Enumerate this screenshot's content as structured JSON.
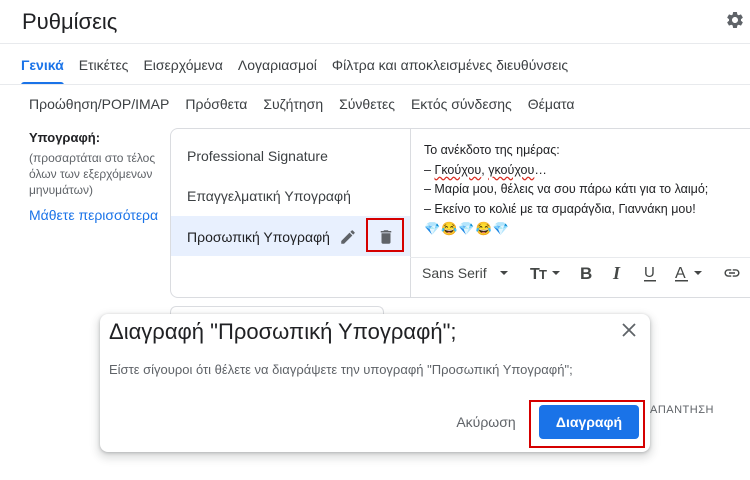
{
  "header": {
    "title": "Ρυθμίσεις",
    "settings_icon": "gear-icon"
  },
  "tabs_row1": [
    "Γενικά",
    "Ετικέτες",
    "Εισερχόμενα",
    "Λογαριασμοί",
    "Φίλτρα και αποκλεισμένες διευθύνσεις"
  ],
  "tabs_row2": [
    "Προώθηση/POP/IMAP",
    "Πρόσθετα",
    "Συζήτηση",
    "Σύνθετες",
    "Εκτός σύνδεσης",
    "Θέματα"
  ],
  "active_tab": "Γενικά",
  "signature_section": {
    "label": "Υπογραφή:",
    "desc_line1": "(προσαρτάται στο τέλος",
    "desc_line2": "όλων των εξερχόμενων",
    "desc_line3": "μηνυμάτων)",
    "learn_more": "Μάθετε περισσότερα"
  },
  "signatures": {
    "item1": "Professional Signature",
    "item2": "Επαγγελματική Υπογραφή",
    "item3": "Προσωπική Υπογραφή"
  },
  "editor": {
    "line1": "Το ανέκδοτο της ημέρας:",
    "line2_prefix": "– ",
    "line2_word1": "Γκούχου",
    "line2_sep": ", ",
    "line2_word2": "γκούχου",
    "line2_suffix": "…",
    "line3": "– Μαρία μου, θέλεις να σου πάρω κάτι για το λαιμό;",
    "line4": "– Εκείνο το κολιέ με τα σμαράγδια, Γιαννάκη μου!",
    "line5": "💎😂💎😂💎"
  },
  "toolbar": {
    "font_name": "Sans Serif"
  },
  "behind_text": "ΑΠΑΝΤΗΣΗ",
  "dialog": {
    "title": "Διαγραφή \"Προσωπική Υπογραφή\";",
    "message": "Είστε σίγουροι ότι θέλετε να διαγράψετε την υπογραφή \"Προσωπική Υπογραφή\";",
    "cancel_label": "Ακύρωση",
    "delete_label": "Διαγραφή"
  },
  "colors": {
    "accent": "#1a73e8",
    "highlight": "#d50000",
    "selected_bg": "#e8f0fe"
  }
}
